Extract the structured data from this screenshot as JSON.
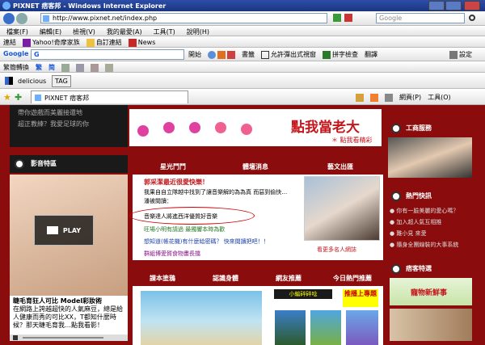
{
  "window": {
    "title": "PIXNET 痞客邦 - Windows Internet Explorer"
  },
  "address": {
    "url": "http://www.pixnet.net/index.php",
    "search_placeholder": "Google"
  },
  "menu": [
    "檔案(F)",
    "編輯(E)",
    "檢視(V)",
    "我的最愛(A)",
    "工具(T)",
    "說明(H)"
  ],
  "links_bar": {
    "label": "連結",
    "items": [
      "Yahoo!奇摩家族",
      "自訂連結",
      "News"
    ]
  },
  "google_bar": {
    "brand": "Google",
    "go_label": "G",
    "open": "開始",
    "bookmarks": "書籤",
    "popup": "允許彈出式視窗",
    "spell": "拼字檢查",
    "translate": "翻譯",
    "settings": "設定"
  },
  "conv_bar": {
    "label": "繁簡轉換",
    "trad": "繁",
    "simp": "简"
  },
  "delicious": {
    "label": "delicious",
    "tag": "TAG"
  },
  "tabs": {
    "current": "PIXNET 痞客邦",
    "page": "網頁(P)",
    "tools": "工具(O)"
  },
  "page": {
    "left_lines": [
      "帶你遊戲而美麗接還地",
      "超正教練？我愛足球的你"
    ],
    "video": {
      "title": "影音特區",
      "play": "PLAY",
      "caption_title": "睫毛育狂人可比 Model彩妝術",
      "caption_text": "在網路上誇越超快的人氣麻豆，總是給人健康而秀的可比XX，T都知什麼時候？那天睫毛育我…點我看影！"
    },
    "banner_text": "點我當老大",
    "banner_sub": "＊ 點我看精彩",
    "news_tabs": [
      "星光鬥鬥",
      "體壇消息",
      "藝文出匯"
    ],
    "news_head": "郭采潔最近很愛快樂！",
    "news_lines": [
      "我果自自立隊越中找到了讓音樂解的為為真 而惡到偷快…",
      "潘被閱讀：",
      "音樂達人將進西洋優質好音樂",
      "旺場小明有請過 最獨響本時為歡",
      "想知道(帳花機)有什麼給密碼？ 快來閱讀把吧！！",
      "群組博愛賀食物畫長擋"
    ],
    "profile_link": "看更多名人網誌",
    "bottom_tabs": [
      "課本塗鴉",
      "認識身體",
      "網友推薦",
      "今日熱門推薦"
    ],
    "ad": {
      "label": "小編碎碎唸",
      "button": "推播上專題"
    },
    "right": {
      "section1": "工商服務",
      "section2": "熱門快訊",
      "links": [
        "你有一臉美麗的愛心嗎？",
        "加入超人氣互相推",
        "難小見 來愛",
        "隨身全團線裝的大事系統"
      ],
      "section3": "痞客特選",
      "ad_text": "寵物新鮮事"
    }
  }
}
